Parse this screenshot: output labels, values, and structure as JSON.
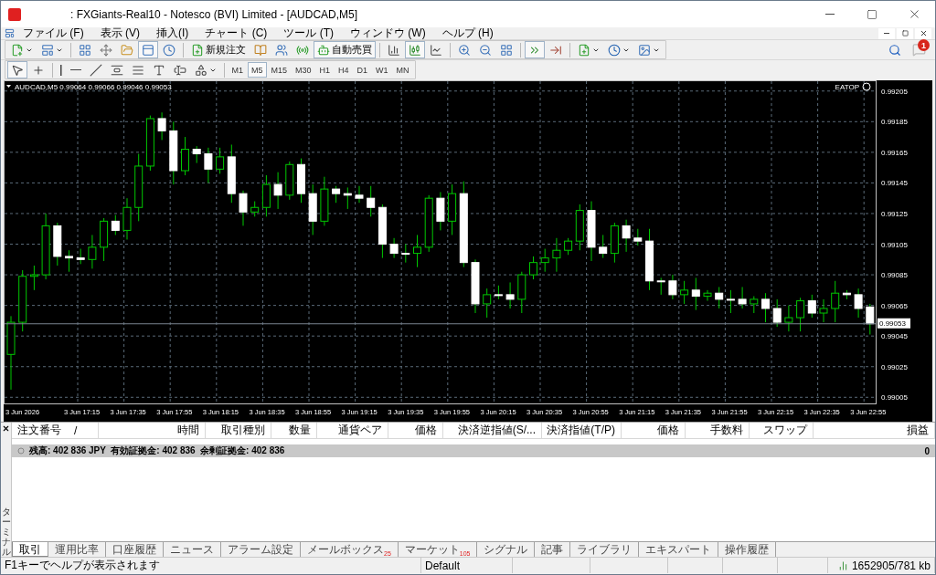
{
  "window": {
    "title": ": FXGiants-Real10 - Notesco (BVI) Limited - [AUDCAD,M5]"
  },
  "menu": [
    "ファイル (F)",
    "表示 (V)",
    "挿入(I)",
    "チャート (C)",
    "ツール (T)",
    "ウィンドウ (W)",
    "ヘルプ (H)"
  ],
  "toolbar_main": [
    {
      "kind": "dropdown",
      "selected": false
    },
    {
      "kind": "dropdown",
      "selected": false
    },
    {
      "kind": "sep"
    },
    {
      "kind": "icon",
      "selected": false
    },
    {
      "kind": "icon",
      "selected": false
    },
    {
      "kind": "icon",
      "selected": false
    },
    {
      "kind": "icon",
      "selected": true
    },
    {
      "kind": "icon",
      "selected": false
    },
    {
      "kind": "sep"
    },
    {
      "kind": "labeled",
      "label": "新規注文",
      "selected": false
    },
    {
      "kind": "icon",
      "selected": false
    },
    {
      "kind": "icon",
      "selected": false
    },
    {
      "kind": "icon",
      "selected": false
    },
    {
      "kind": "labeled",
      "label": "自動売買",
      "selected": true
    },
    {
      "kind": "sep"
    },
    {
      "kind": "icon",
      "selected": false
    },
    {
      "kind": "icon",
      "selected": true
    },
    {
      "kind": "icon",
      "selected": false
    },
    {
      "kind": "sep"
    },
    {
      "kind": "icon",
      "selected": false
    },
    {
      "kind": "icon",
      "selected": false
    },
    {
      "kind": "icon",
      "selected": false
    },
    {
      "kind": "sep"
    },
    {
      "kind": "icon",
      "selected": true
    },
    {
      "kind": "icon",
      "selected": false
    },
    {
      "kind": "sep"
    },
    {
      "kind": "dropdown",
      "selected": false
    },
    {
      "kind": "dropdown",
      "selected": false
    },
    {
      "kind": "dropdown",
      "selected": false
    }
  ],
  "notifications": {
    "badge": "1"
  },
  "toolbar_draw": [
    {
      "kind": "icon",
      "selected": true
    },
    {
      "kind": "icon",
      "selected": false
    },
    {
      "kind": "sep"
    },
    {
      "kind": "icon",
      "selected": false
    },
    {
      "kind": "icon",
      "selected": false
    },
    {
      "kind": "icon",
      "selected": false
    },
    {
      "kind": "icon",
      "selected": false
    },
    {
      "kind": "icon",
      "selected": false
    },
    {
      "kind": "icon",
      "selected": false
    },
    {
      "kind": "icon",
      "selected": false
    },
    {
      "kind": "dropdown",
      "selected": false
    }
  ],
  "timeframes": [
    {
      "label": "M1",
      "selected": false
    },
    {
      "label": "M5",
      "selected": true
    },
    {
      "label": "M15",
      "selected": false
    },
    {
      "label": "M30",
      "selected": false
    },
    {
      "label": "H1",
      "selected": false
    },
    {
      "label": "H4",
      "selected": false
    },
    {
      "label": "D1",
      "selected": false
    },
    {
      "label": "W1",
      "selected": false
    },
    {
      "label": "MN",
      "selected": false
    }
  ],
  "chart": {
    "symbol": "AUDCAD,M5",
    "quotes": "0.99064 0.99066 0.99046 0.99053",
    "expert": "EATOP",
    "price_axis": [
      "0.99205",
      "0.99185",
      "0.99165",
      "0.99145",
      "0.99125",
      "0.99105",
      "0.99085",
      "0.99065",
      "0.99045",
      "0.99025",
      "0.99005"
    ],
    "chart_data": {
      "type": "candlestick",
      "grid": true,
      "ylim": [
        0.99001,
        0.99212
      ],
      "ref_lines": [
        {
          "axis": "y",
          "value": 0.99053,
          "label": "0.99053",
          "color": "#7a8590"
        }
      ],
      "yticks": [
        0.99205,
        0.99185,
        0.99165,
        0.99145,
        0.99125,
        0.99105,
        0.99085,
        0.99065,
        0.99045,
        0.99025,
        0.99005
      ],
      "ohlc": [
        [
          0.99033,
          0.99058,
          0.9901,
          0.99054
        ],
        [
          0.99054,
          0.99088,
          0.99048,
          0.99084
        ],
        [
          0.99084,
          0.99091,
          0.99075,
          0.99085
        ],
        [
          0.99085,
          0.99125,
          0.99082,
          0.99117
        ],
        [
          0.99117,
          0.99119,
          0.99091,
          0.99097
        ],
        [
          0.99097,
          0.99101,
          0.99087,
          0.99096
        ],
        [
          0.99096,
          0.99102,
          0.99092,
          0.99095
        ],
        [
          0.99095,
          0.99111,
          0.99089,
          0.99103
        ],
        [
          0.99103,
          0.99122,
          0.99094,
          0.9912
        ],
        [
          0.9912,
          0.99124,
          0.99111,
          0.99114
        ],
        [
          0.99114,
          0.99135,
          0.99108,
          0.99129
        ],
        [
          0.99129,
          0.99164,
          0.9912,
          0.99156
        ],
        [
          0.99156,
          0.99189,
          0.99153,
          0.99187
        ],
        [
          0.99187,
          0.99191,
          0.99173,
          0.99179
        ],
        [
          0.99179,
          0.99185,
          0.99144,
          0.99153
        ],
        [
          0.99153,
          0.99175,
          0.9915,
          0.99167
        ],
        [
          0.99167,
          0.99169,
          0.99158,
          0.99164
        ],
        [
          0.99164,
          0.99168,
          0.99145,
          0.99154
        ],
        [
          0.99154,
          0.99168,
          0.99151,
          0.99162
        ],
        [
          0.99162,
          0.9917,
          0.99132,
          0.99138
        ],
        [
          0.99138,
          0.9914,
          0.99117,
          0.99126
        ],
        [
          0.99126,
          0.99133,
          0.99123,
          0.99129
        ],
        [
          0.99129,
          0.9915,
          0.99123,
          0.99144
        ],
        [
          0.99144,
          0.99152,
          0.99128,
          0.99137
        ],
        [
          0.99137,
          0.99159,
          0.99134,
          0.99157
        ],
        [
          0.99157,
          0.99161,
          0.99132,
          0.99138
        ],
        [
          0.99138,
          0.99144,
          0.99111,
          0.9912
        ],
        [
          0.9912,
          0.99149,
          0.99117,
          0.99141
        ],
        [
          0.99141,
          0.99143,
          0.99132,
          0.99138
        ],
        [
          0.99138,
          0.99142,
          0.99128,
          0.99137
        ],
        [
          0.99137,
          0.99143,
          0.99132,
          0.99135
        ],
        [
          0.99135,
          0.99143,
          0.99123,
          0.99129
        ],
        [
          0.99129,
          0.99131,
          0.99096,
          0.99105
        ],
        [
          0.99105,
          0.99109,
          0.99096,
          0.99099
        ],
        [
          0.99099,
          0.99105,
          0.99093,
          0.99099
        ],
        [
          0.99099,
          0.99111,
          0.9909,
          0.99103
        ],
        [
          0.99103,
          0.99137,
          0.991,
          0.99135
        ],
        [
          0.99135,
          0.99139,
          0.99114,
          0.9912
        ],
        [
          0.9912,
          0.99144,
          0.99111,
          0.99138
        ],
        [
          0.99138,
          0.99146,
          0.9909,
          0.99093
        ],
        [
          0.99093,
          0.99095,
          0.9906,
          0.99066
        ],
        [
          0.99066,
          0.99076,
          0.99057,
          0.99072
        ],
        [
          0.99072,
          0.99078,
          0.99069,
          0.99072
        ],
        [
          0.99072,
          0.9908,
          0.99063,
          0.99069
        ],
        [
          0.99069,
          0.99087,
          0.9906,
          0.99085
        ],
        [
          0.99085,
          0.99097,
          0.99082,
          0.99093
        ],
        [
          0.99093,
          0.99102,
          0.99087,
          0.99096
        ],
        [
          0.99096,
          0.99109,
          0.99087,
          0.99101
        ],
        [
          0.99101,
          0.99109,
          0.99098,
          0.99107
        ],
        [
          0.99107,
          0.99131,
          0.99101,
          0.99127
        ],
        [
          0.99127,
          0.99133,
          0.99094,
          0.99103
        ],
        [
          0.99103,
          0.99111,
          0.99096,
          0.99099
        ],
        [
          0.99099,
          0.99119,
          0.99093,
          0.99117
        ],
        [
          0.99117,
          0.99121,
          0.991,
          0.99109
        ],
        [
          0.99109,
          0.99115,
          0.99104,
          0.99107
        ],
        [
          0.99107,
          0.99115,
          0.99075,
          0.99081
        ],
        [
          0.99081,
          0.99083,
          0.99072,
          0.99081
        ],
        [
          0.99081,
          0.99085,
          0.99069,
          0.99072
        ],
        [
          0.99072,
          0.99081,
          0.99066,
          0.99075
        ],
        [
          0.99075,
          0.99083,
          0.99062,
          0.99071
        ],
        [
          0.99071,
          0.99075,
          0.99068,
          0.99073
        ],
        [
          0.99073,
          0.99077,
          0.99063,
          0.99069
        ],
        [
          0.99069,
          0.99075,
          0.9906,
          0.99069
        ],
        [
          0.99069,
          0.99077,
          0.99063,
          0.99066
        ],
        [
          0.99066,
          0.99071,
          0.9906,
          0.99069
        ],
        [
          0.99069,
          0.99073,
          0.99054,
          0.99063
        ],
        [
          0.99063,
          0.99069,
          0.99051,
          0.99054
        ],
        [
          0.99054,
          0.99065,
          0.99048,
          0.99057
        ],
        [
          0.99057,
          0.9907,
          0.99048,
          0.99068
        ],
        [
          0.99068,
          0.99072,
          0.99057,
          0.9906
        ],
        [
          0.9906,
          0.99069,
          0.99054,
          0.99063
        ],
        [
          0.99063,
          0.99081,
          0.99054,
          0.99073
        ],
        [
          0.99073,
          0.99075,
          0.99069,
          0.99072
        ],
        [
          0.99072,
          0.99076,
          0.99057,
          0.99063
        ],
        [
          0.99064,
          0.99066,
          0.99046,
          0.99053
        ]
      ]
    },
    "time_axis": [
      "3 Jun 2026",
      "3 Jun 17:15",
      "3 Jun 17:35",
      "3 Jun 17:55",
      "3 Jun 18:15",
      "3 Jun 18:35",
      "3 Jun 18:55",
      "3 Jun 19:15",
      "3 Jun 19:35",
      "3 Jun 19:55",
      "3 Jun 20:15",
      "3 Jun 20:35",
      "3 Jun 20:55",
      "3 Jun 21:15",
      "3 Jun 21:35",
      "3 Jun 21:55",
      "3 Jun 22:15",
      "3 Jun 22:35",
      "3 Jun 22:55"
    ]
  },
  "terminal": {
    "side_label": "ターミナル",
    "sort_mark": "/",
    "columns": [
      "注文番号",
      "時間",
      "取引種別",
      "数量",
      "通貨ペア",
      "価格",
      "決済逆指値(S/...",
      "決済指値(T/P)",
      "価格",
      "手数料",
      "スワップ",
      "損益"
    ],
    "balance_row": {
      "text": "残高: 402 836 JPY  有効証拠金: 402 836  余剰証拠金: 402 836",
      "profit": "0"
    },
    "tabs": [
      {
        "label": "取引",
        "selected": true
      },
      {
        "label": "運用比率",
        "selected": false
      },
      {
        "label": "口座履歴",
        "selected": false
      },
      {
        "label": "ニュース",
        "selected": false
      },
      {
        "label": "アラーム設定",
        "selected": false
      },
      {
        "label": "メールボックス",
        "badge": "25",
        "selected": false
      },
      {
        "label": "マーケット",
        "badge": "105",
        "selected": false
      },
      {
        "label": "シグナル",
        "selected": false
      },
      {
        "label": "記事",
        "selected": false
      },
      {
        "label": "ライブラリ",
        "selected": false
      },
      {
        "label": "エキスパート",
        "selected": false
      },
      {
        "label": "操作履歴",
        "selected": false
      }
    ]
  },
  "status_bar": {
    "help": "F1キーでヘルプが表示されます",
    "profile": "Default",
    "traffic": "1652905/781 kb"
  }
}
